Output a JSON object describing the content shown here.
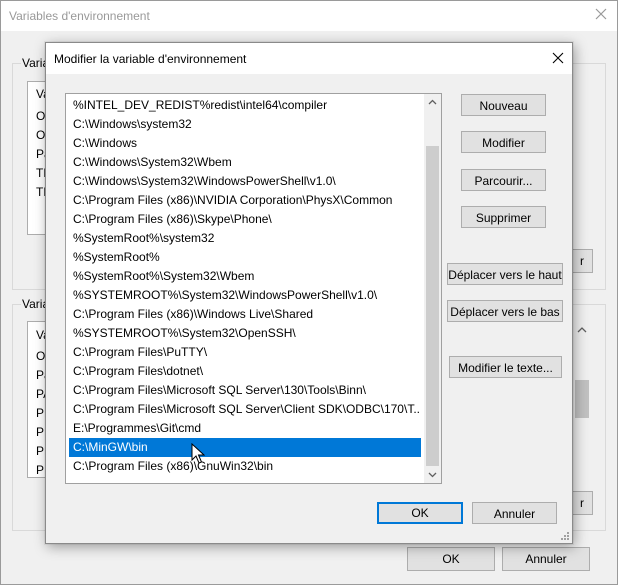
{
  "background_window": {
    "title": "Variables d'environnement",
    "user_group_label": "Varia",
    "user_list_lines": [
      "Va",
      "On",
      "On",
      "Pa",
      "TE",
      "TN"
    ],
    "system_group_label": "Varia",
    "system_list_lines": [
      "Va",
      "OS",
      "Pa",
      "PA",
      "PR",
      "PR",
      "PR",
      "PR"
    ],
    "partial_button_1": "r",
    "partial_button_2": "r",
    "ok_label": "OK",
    "cancel_label": "Annuler"
  },
  "dialog": {
    "title": "Modifier la variable d'environnement",
    "paths": [
      "%INTEL_DEV_REDIST%redist\\intel64\\compiler",
      "C:\\Windows\\system32",
      "C:\\Windows",
      "C:\\Windows\\System32\\Wbem",
      "C:\\Windows\\System32\\WindowsPowerShell\\v1.0\\",
      "C:\\Program Files (x86)\\NVIDIA Corporation\\PhysX\\Common",
      "C:\\Program Files (x86)\\Skype\\Phone\\",
      "%SystemRoot%\\system32",
      "%SystemRoot%",
      "%SystemRoot%\\System32\\Wbem",
      "%SYSTEMROOT%\\System32\\WindowsPowerShell\\v1.0\\",
      "C:\\Program Files (x86)\\Windows Live\\Shared",
      "%SYSTEMROOT%\\System32\\OpenSSH\\",
      "C:\\Program Files\\PuTTY\\",
      "C:\\Program Files\\dotnet\\",
      "C:\\Program Files\\Microsoft SQL Server\\130\\Tools\\Binn\\",
      "C:\\Program Files\\Microsoft SQL Server\\Client SDK\\ODBC\\170\\T...",
      "E:\\Programmes\\Git\\cmd",
      "C:\\MinGW\\bin",
      "C:\\Program Files (x86)\\GnuWin32\\bin"
    ],
    "selected_index": 18,
    "buttons": {
      "new": "Nouveau",
      "edit": "Modifier",
      "browse": "Parcourir...",
      "delete": "Supprimer",
      "move_up": "Déplacer vers le haut",
      "move_down": "Déplacer vers le bas",
      "edit_text": "Modifier le texte...",
      "ok": "OK",
      "cancel": "Annuler"
    },
    "accent_color": "#0078d7"
  }
}
